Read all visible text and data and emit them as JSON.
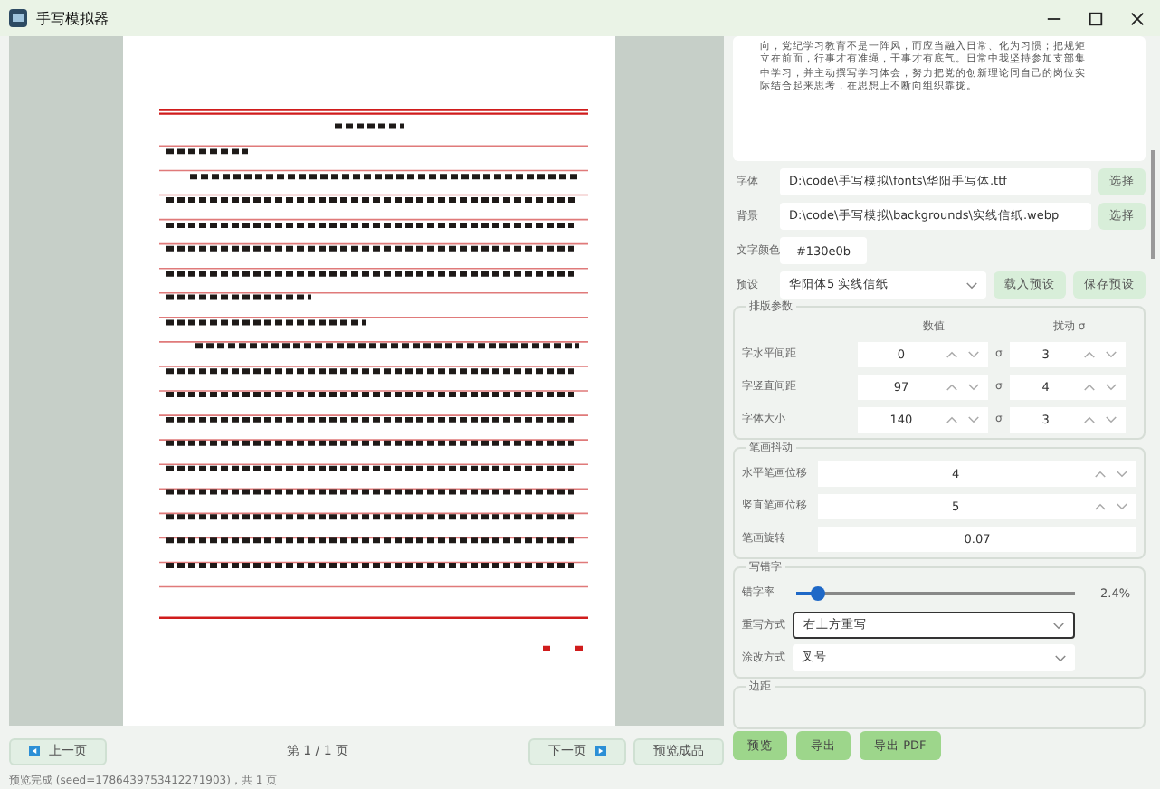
{
  "window": {
    "title": "手写模拟器"
  },
  "preview": {
    "kind": "picture"
  },
  "pager": {
    "prev": "上一页",
    "page": "第 1 / 1 页",
    "next": "下一页",
    "extra": "预览成品"
  },
  "status": "预览完成 (seed=1786439753412271903)，共 1 页",
  "text_input": {
    "lines": [
      "向，党纪学习教育不是一阵风，而应当融入日常、化为习惯；把规矩",
      "立在前面，行事才有准绳，干事才有底气。日常中我坚持参加支部集",
      "中学习，并主动撰写学习体会，努力把党的创新理论同自己的岗位实",
      "际结合起来思考，在思想上不断向组织靠拢。"
    ]
  },
  "files": [
    {
      "label": "字体",
      "value": "D:\\code\\手写模拟\\fonts\\华阳手写体.ttf",
      "button": "选择"
    },
    {
      "label": "背景",
      "value": "D:\\code\\手写模拟\\backgrounds\\实线信纸.webp",
      "button": "选择"
    }
  ],
  "text_color": {
    "label": "文字颜色",
    "value": "#130e0b"
  },
  "preset": {
    "label": "预设",
    "value": "华阳体5 实线信纸",
    "buttons": [
      "载入预设",
      "保存预设"
    ]
  },
  "layout": {
    "title": "排版参数",
    "columns": [
      "数值",
      "扰动 σ"
    ],
    "rows": [
      {
        "label": "字水平间距",
        "value": "0",
        "sigma_symbol": "σ",
        "sigma": "3"
      },
      {
        "label": "字竖直间距",
        "value": "97",
        "sigma_symbol": "σ",
        "sigma": "4"
      },
      {
        "label": "字体大小",
        "value": "140",
        "sigma_symbol": "σ",
        "sigma": "3"
      }
    ]
  },
  "jitter": {
    "title": "笔画抖动",
    "rows": [
      {
        "label": "水平笔画位移",
        "value": "4",
        "kind": "spin"
      },
      {
        "label": "竖直笔画位移",
        "value": "5",
        "kind": "spin"
      },
      {
        "label": "笔画旋转",
        "value": "0.07",
        "kind": "plain"
      }
    ]
  },
  "typos": {
    "title": "写错字",
    "rate": {
      "label": "错字率",
      "level": 0.08,
      "reading": "2.4%"
    },
    "selects": [
      {
        "label": "重写方式",
        "value": "右上方重写",
        "focused": true
      },
      {
        "label": "涂改方式",
        "value": "叉号",
        "focused": false
      }
    ]
  },
  "margin": {
    "title": "边距"
  },
  "actions": [
    "预览",
    "导出",
    "导出 PDF"
  ]
}
